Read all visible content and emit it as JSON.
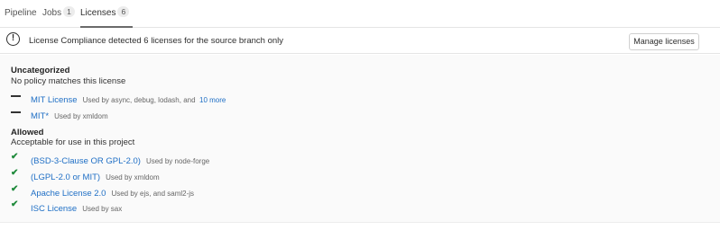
{
  "tabs": [
    {
      "label": "Pipeline"
    },
    {
      "label": "Jobs",
      "count": "1"
    },
    {
      "label": "Licenses",
      "count": "6"
    }
  ],
  "banner": {
    "icon": "exclamation-circle-icon",
    "text": "License Compliance detected 6 licenses for the source branch only",
    "button_label": "Manage licenses"
  },
  "groups": [
    {
      "title": "Uncategorized",
      "description": "No policy matches this license",
      "items": [
        {
          "status_icon": "dash-icon",
          "name": "MIT License",
          "used_by": "Used by async, debug, lodash, and",
          "more": "10 more"
        },
        {
          "status_icon": "dash-icon",
          "name": "MIT*",
          "used_by": "Used by xmldom"
        }
      ]
    },
    {
      "title": "Allowed",
      "description": "Acceptable for use in this project",
      "items": [
        {
          "status_icon": "check-icon",
          "name": "(BSD-3-Clause OR GPL-2.0)",
          "used_by": "Used by node-forge"
        },
        {
          "status_icon": "check-icon",
          "name": "(LGPL-2.0 or MIT)",
          "used_by": "Used by xmldom"
        },
        {
          "status_icon": "check-icon",
          "name": "Apache License 2.0",
          "used_by": "Used by ejs, and saml2-js"
        },
        {
          "status_icon": "check-icon",
          "name": "ISC License",
          "used_by": "Used by sax"
        }
      ]
    }
  ],
  "colors": {
    "link": "#1f6fc5",
    "check": "#1f8a3b",
    "panel_bg": "#fafafa"
  }
}
